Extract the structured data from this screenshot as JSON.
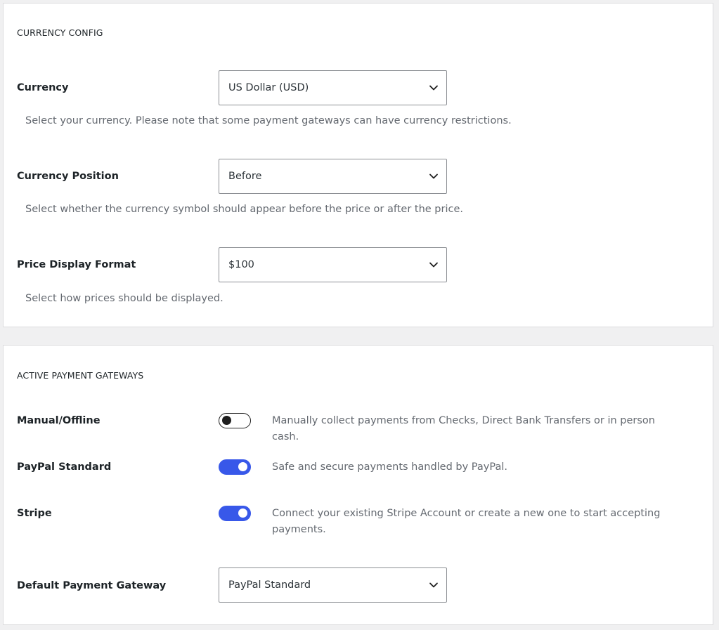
{
  "currency_config": {
    "title": "CURRENCY CONFIG",
    "currency": {
      "label": "Currency",
      "value": "US Dollar (USD)",
      "help": "Select your currency. Please note that some payment gateways can have currency restrictions."
    },
    "position": {
      "label": "Currency Position",
      "value": "Before",
      "help": "Select whether the currency symbol should appear before the price or after the price."
    },
    "format": {
      "label": "Price Display Format",
      "value": "$100",
      "help": "Select how prices should be displayed."
    }
  },
  "payment_gateways": {
    "title": "ACTIVE PAYMENT GATEWAYS",
    "gateways": [
      {
        "label": "Manual/Offline",
        "enabled": false,
        "description": "Manually collect payments from Checks, Direct Bank Transfers or in person cash."
      },
      {
        "label": "PayPal Standard",
        "enabled": true,
        "description": "Safe and secure payments handled by PayPal."
      },
      {
        "label": "Stripe",
        "enabled": true,
        "description": "Connect your existing Stripe Account or create a new one to start accepting payments."
      }
    ],
    "default_gateway": {
      "label": "Default Payment Gateway",
      "value": "PayPal Standard"
    }
  },
  "colors": {
    "toggle_on": "#3858e9",
    "toggle_off_border": "#1e1e1e",
    "help_text": "#646970"
  },
  "icons": {
    "select_arrow": "chevron-down-icon",
    "toggle_knob": "toggle-knob"
  }
}
